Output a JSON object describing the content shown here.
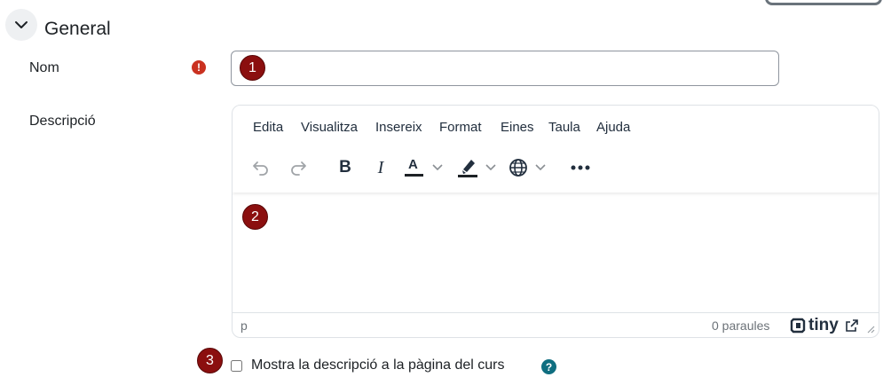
{
  "section": {
    "title": "General"
  },
  "fields": {
    "name": {
      "label": "Nom",
      "required_icon": "exclamation-icon",
      "value": "",
      "placeholder": ""
    },
    "description": {
      "label": "Descripció"
    }
  },
  "editor": {
    "menus": [
      "Edita",
      "Visualitza",
      "Insereix",
      "Format",
      "Eines",
      "Taula",
      "Ajuda"
    ],
    "toolbar_icons": [
      "undo-icon",
      "redo-icon",
      "bold-icon",
      "italic-icon",
      "text-color-icon",
      "highlight-color-icon",
      "language-icon",
      "more-icon"
    ],
    "bold_glyph": "B",
    "italic_glyph": "I",
    "text_color_glyph": "A",
    "text_color": "#1d2125",
    "highlight_color": "#1d2125",
    "status_path": "p",
    "word_count": "0 paraules",
    "brand": "tiny"
  },
  "show_description": {
    "label": "Mostra la descripció a la pàgina del curs",
    "checked": false,
    "help_glyph": "?"
  },
  "badges": [
    "1",
    "2",
    "3"
  ],
  "colors": {
    "badge": "#8b0f0f",
    "required": "#ca3120",
    "help": "#0f6e80"
  }
}
